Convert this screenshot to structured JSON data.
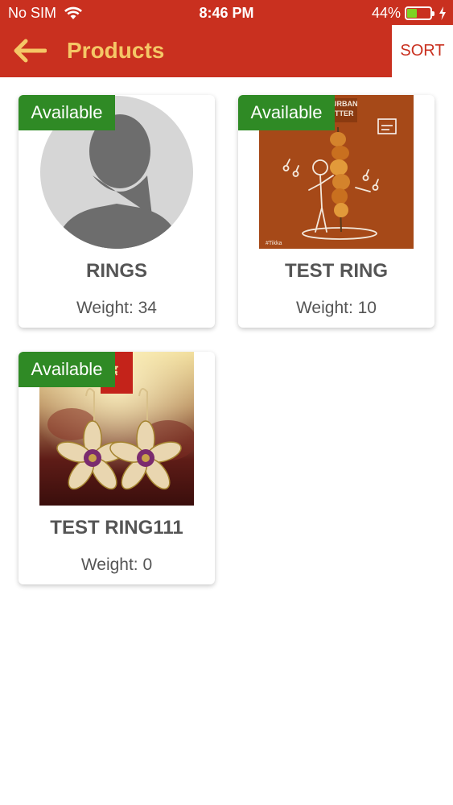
{
  "status_bar": {
    "carrier": "No SIM",
    "time": "8:46 PM",
    "battery_percent": "44%",
    "battery_level": 0.44,
    "battery_color": "#7ed321"
  },
  "navbar": {
    "back_icon": "arrow-left-icon",
    "title": "Products",
    "sort_label": "SORT",
    "bar_color": "#c9301f",
    "title_color": "#f5c766"
  },
  "products": [
    {
      "badge": "Available",
      "name": "RINGS",
      "weight_label": "Weight: 34",
      "image": "person-placeholder"
    },
    {
      "badge": "Available",
      "name": "TEST RING",
      "weight_label": "Weight: 10",
      "image": "poster"
    },
    {
      "badge": "Available",
      "name": "TEST RING111",
      "weight_label": "Weight: 0",
      "image": "earrings"
    }
  ],
  "poster_text": {
    "line1": "URBAN",
    "line2": "TTER",
    "hashtag": "#Tikka"
  },
  "earring_logo_text": "नंद"
}
